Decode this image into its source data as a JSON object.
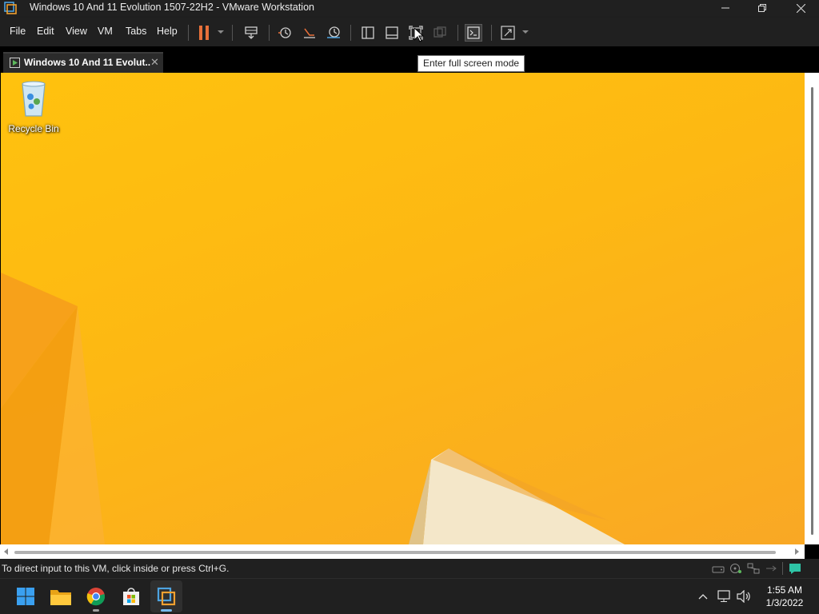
{
  "window": {
    "title": "Windows 10 And 11 Evolution 1507-22H2 - VMware Workstation"
  },
  "menu": {
    "items": [
      "File",
      "Edit",
      "View",
      "VM",
      "Tabs",
      "Help"
    ]
  },
  "toolbar": {
    "icons": [
      "pause-icon",
      "send-ctrl-alt-del-icon",
      "snapshot-icon",
      "revert-snapshot-icon",
      "snapshot-manager-icon",
      "library-view-icon",
      "thumbnail-bar-icon",
      "full-screen-icon",
      "unity-icon",
      "console-view-icon",
      "stretch-guest-icon"
    ]
  },
  "tabs": [
    {
      "label": "Windows 10 And 11 Evolut...",
      "active": true
    }
  ],
  "tooltip": {
    "text": "Enter full screen mode"
  },
  "desktop": {
    "icons": [
      {
        "label": "Recycle Bin",
        "icon": "recycle-bin-icon"
      }
    ],
    "wallpaper_colors": [
      "#ffc20e",
      "#fdb813",
      "#f9a825"
    ]
  },
  "statusbar": {
    "message": "To direct input to this VM, click inside or press Ctrl+G."
  },
  "taskbar": {
    "apps": [
      {
        "name": "start-icon",
        "active": false
      },
      {
        "name": "file-explorer-icon",
        "active": false
      },
      {
        "name": "chrome-icon",
        "active": false,
        "running": true
      },
      {
        "name": "microsoft-store-icon",
        "active": false
      },
      {
        "name": "vmware-workstation-icon",
        "active": true,
        "running": true
      }
    ],
    "clock": {
      "time": "1:55 AM",
      "date": "1/3/2022"
    }
  },
  "colors": {
    "chrome_bg": "#202020",
    "accent": "#76b9ed",
    "pause_orange": "#e8703a"
  }
}
